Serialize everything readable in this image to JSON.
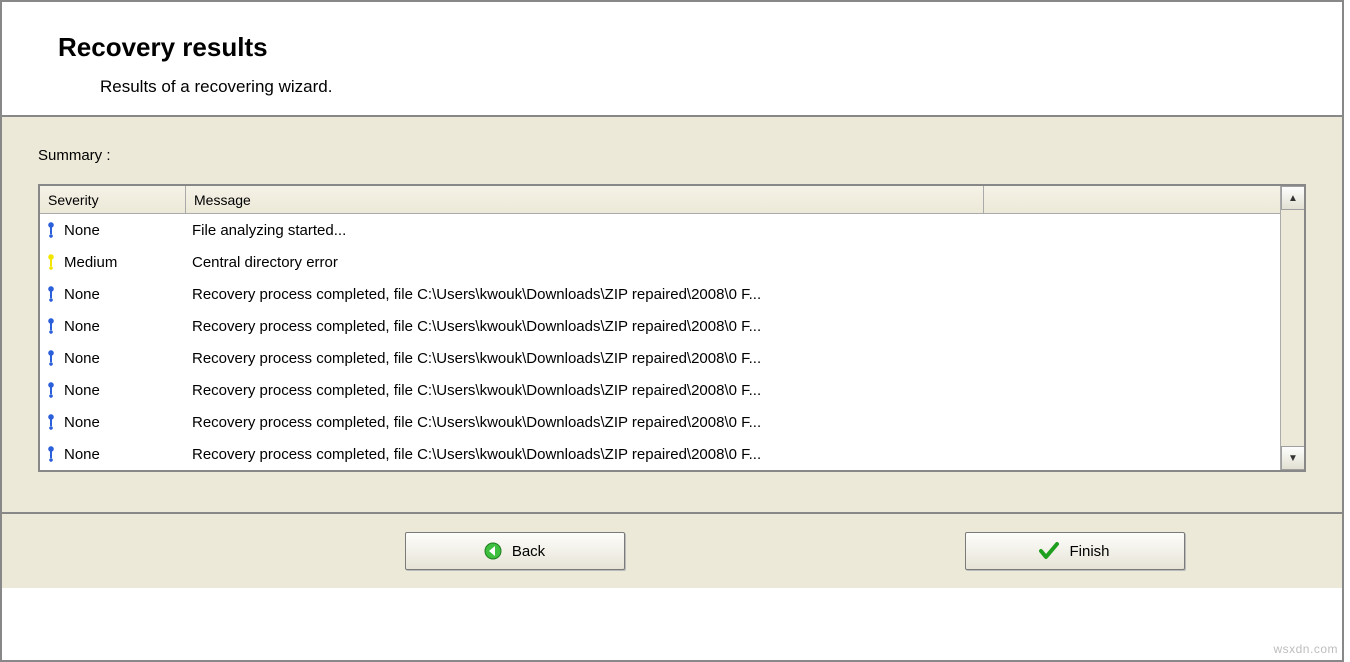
{
  "header": {
    "title": "Recovery results",
    "subtitle": "Results of a recovering wizard."
  },
  "summary_label": "Summary :",
  "columns": {
    "severity": "Severity",
    "message": "Message"
  },
  "rows": [
    {
      "severity": "None",
      "icon": "info-blue",
      "message": "File analyzing started..."
    },
    {
      "severity": "Medium",
      "icon": "info-yellow",
      "message": "Central directory error"
    },
    {
      "severity": "None",
      "icon": "info-blue",
      "message": "Recovery process completed, file C:\\Users\\kwouk\\Downloads\\ZIP repaired\\2008\\0 F..."
    },
    {
      "severity": "None",
      "icon": "info-blue",
      "message": "Recovery process completed, file C:\\Users\\kwouk\\Downloads\\ZIP repaired\\2008\\0 F..."
    },
    {
      "severity": "None",
      "icon": "info-blue",
      "message": "Recovery process completed, file C:\\Users\\kwouk\\Downloads\\ZIP repaired\\2008\\0 F..."
    },
    {
      "severity": "None",
      "icon": "info-blue",
      "message": "Recovery process completed, file C:\\Users\\kwouk\\Downloads\\ZIP repaired\\2008\\0 F..."
    },
    {
      "severity": "None",
      "icon": "info-blue",
      "message": "Recovery process completed, file C:\\Users\\kwouk\\Downloads\\ZIP repaired\\2008\\0 F..."
    },
    {
      "severity": "None",
      "icon": "info-blue",
      "message": "Recovery process completed, file C:\\Users\\kwouk\\Downloads\\ZIP repaired\\2008\\0 F..."
    }
  ],
  "buttons": {
    "back": "Back",
    "finish": "Finish"
  },
  "watermark": "wsxdn.com"
}
